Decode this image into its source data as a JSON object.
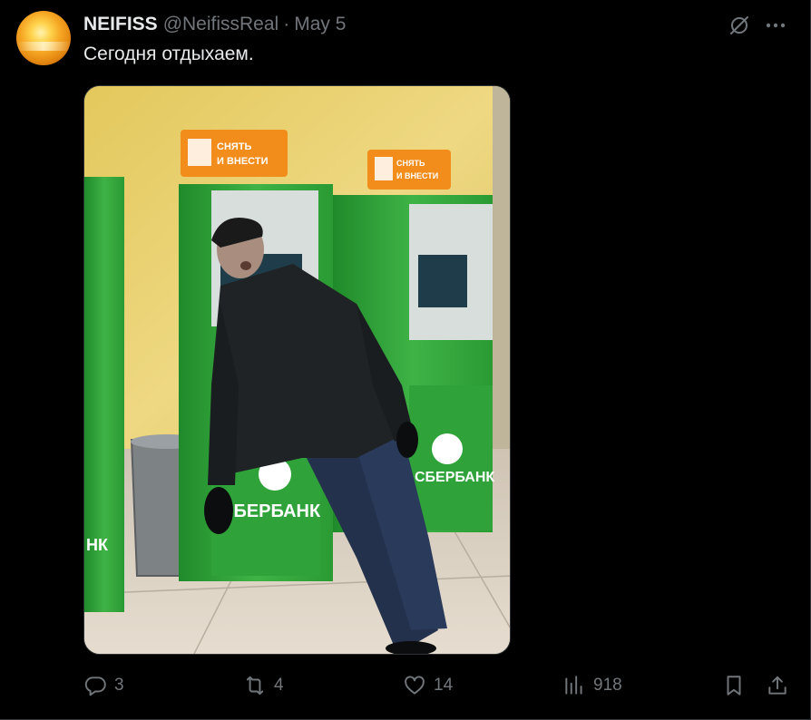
{
  "user": {
    "display_name": "NEIFISS",
    "handle": "@NeifissReal",
    "separator": "·",
    "date": "May 5",
    "avatar_icon": "sunset-avatar"
  },
  "post": {
    "text": "Сегодня отдыхаем.",
    "image": {
      "sign_text_line1": "СНЯТЬ",
      "sign_text_line2": "И ВНЕСТИ",
      "bank_label": "СБЕРБАНК",
      "bank_label_partial_left": "НК",
      "bank_label_partial_right": "СБЕРБАНК"
    }
  },
  "actions": {
    "reply_count": "3",
    "retweet_count": "4",
    "like_count": "14",
    "views_count": "918"
  },
  "icons": {
    "grok": "grok-icon",
    "more": "more-icon",
    "reply": "reply-icon",
    "retweet": "retweet-icon",
    "like": "heart-icon",
    "views": "views-icon",
    "bookmark": "bookmark-icon",
    "share": "share-icon"
  },
  "colors": {
    "background": "#000000",
    "text": "#e7e9ea",
    "muted": "#71767b",
    "atm_green": "#3aa83a",
    "sign_orange": "#f28c1b",
    "wall_yellow": "#e9cf6a"
  }
}
